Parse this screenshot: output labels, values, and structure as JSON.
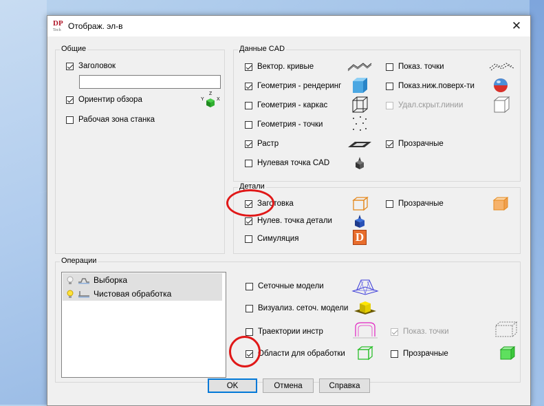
{
  "window": {
    "title": "Отображ. эл-в",
    "app_logo": "DP",
    "app_logo_sub": "Tech"
  },
  "general": {
    "title": "Общие",
    "header_checkbox": {
      "label": "Заголовок",
      "checked": true
    },
    "header_text": "",
    "view_orient": {
      "label": "Ориентир обзора",
      "checked": true,
      "axis_x": "X",
      "axis_y": "Y",
      "axis_z": "Z"
    },
    "machine_zone": {
      "label": "Рабочая зона станка",
      "checked": false
    }
  },
  "cad": {
    "title": "Данные CAD",
    "vector_curves": {
      "label": "Вектор. кривые",
      "checked": true,
      "icon": "vector-curves-icon"
    },
    "geom_render": {
      "label": "Геометрия - рендеринг",
      "checked": true,
      "icon": "render-cube-icon"
    },
    "geom_wire": {
      "label": "Геометрия - каркас",
      "checked": false,
      "icon": "wire-cube-icon"
    },
    "geom_points": {
      "label": "Геометрия - точки",
      "checked": false,
      "icon": "points-icon"
    },
    "raster": {
      "label": "Растр",
      "checked": true,
      "icon": "raster-icon"
    },
    "cad_zero": {
      "label": "Нулевая точка CAD",
      "checked": false,
      "icon": "cad-zero-icon"
    },
    "show_points": {
      "label": "Показ. точки",
      "checked": false,
      "icon": "show-points-icon"
    },
    "show_lower_surf": {
      "label": "Показ.ниж.поверх-ти",
      "checked": false,
      "icon": "lower-surface-icon"
    },
    "hidden_lines": {
      "label": "Удал.скрыт.линии",
      "checked": false,
      "disabled": true,
      "icon": "hidden-lines-icon"
    },
    "transparent": {
      "label": "Прозрачные",
      "checked": true
    }
  },
  "parts": {
    "title": "Детали",
    "stock": {
      "label": "Заготовка",
      "checked": true,
      "icon": "stock-icon"
    },
    "part_zero": {
      "label": "Нулев. точка детали",
      "checked": true,
      "icon": "part-zero-icon"
    },
    "simulation": {
      "label": "Симуляция",
      "checked": false,
      "icon": "simulation-icon",
      "glyph": "D"
    },
    "transparent": {
      "label": "Прозрачные",
      "checked": false,
      "icon": "stock-transparent-icon"
    }
  },
  "operations": {
    "title": "Операции",
    "items": [
      {
        "label": "Выборка",
        "bulb_on": false
      },
      {
        "label": "Чистовая обработка",
        "bulb_on": true
      }
    ],
    "mesh_models": {
      "label": "Сеточные модели",
      "checked": false,
      "icon": "mesh-model-icon"
    },
    "mesh_visual": {
      "label": "Визуализ. сеточ. модели",
      "checked": false,
      "icon": "mesh-visual-icon"
    },
    "tool_paths": {
      "label": "Траектории инстр",
      "checked": false,
      "icon": "toolpath-icon"
    },
    "show_points": {
      "label": "Показ. точки",
      "checked": true,
      "disabled": true,
      "icon": "toolpath-points-icon"
    },
    "machining_areas": {
      "label": "Области для обработки",
      "checked": true,
      "icon": "machining-area-icon"
    },
    "transparent": {
      "label": "Прозрачные",
      "checked": false,
      "icon": "machining-area-transparent-icon"
    }
  },
  "buttons": {
    "ok": "OK",
    "cancel": "Отмена",
    "help": "Справка"
  },
  "colors": {
    "accent": "#0078d7",
    "annotation": "#e01818"
  }
}
